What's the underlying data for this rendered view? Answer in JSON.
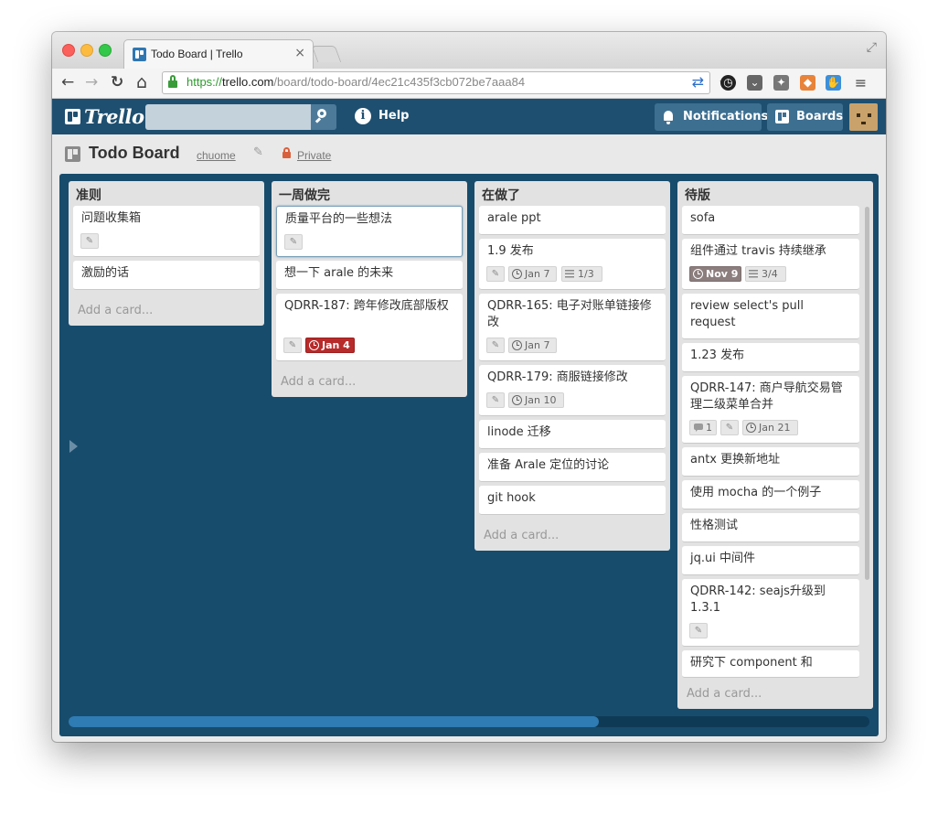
{
  "browser": {
    "tab_title": "Todo Board | Trello",
    "tab_close": "×",
    "url_scheme": "https://",
    "url_host": "trello.com",
    "url_path": "/board/todo-board/4ec21c435f3cb072be7aaa84",
    "nav": {
      "back": "←",
      "forward": "→",
      "reload": "↻",
      "home": "⌂"
    },
    "extension_icons": [
      "redirect-icon",
      "star-icon",
      "clock-extension-icon",
      "pocket-icon",
      "puzzle-icon",
      "shield-icon",
      "hand-icon",
      "menu-icon"
    ]
  },
  "header": {
    "logo": "Trello",
    "search_value": "",
    "help_label": "Help",
    "help_icon": "i",
    "notifications_label": "Notifications",
    "boards_label": "Boards"
  },
  "board": {
    "title": "Todo Board",
    "org": "chuome",
    "visibility": "Private"
  },
  "lists": [
    {
      "title": "准则",
      "add_card": "Add a card...",
      "cards": [
        {
          "title": "问题收集箱"
        },
        {
          "title": "激励的话"
        }
      ]
    },
    {
      "title": "一周做完",
      "add_card": "Add a card...",
      "cards": [
        {
          "title": "质量平台的一些想法"
        },
        {
          "title": "想一下 arale 的未来"
        },
        {
          "title": "QDRR-187: 跨年修改底部版权",
          "due": "Jan 4"
        }
      ]
    },
    {
      "title": "在做了",
      "add_card": "Add a card...",
      "cards": [
        {
          "title": "arale ppt"
        },
        {
          "title": "1.9 发布",
          "due": "Jan 7",
          "checklist": "1/3"
        },
        {
          "title": "QDRR-165: 电子对账单链接修改",
          "due": "Jan 7"
        },
        {
          "title": "QDRR-179: 商服链接修改",
          "due": "Jan 10"
        },
        {
          "title": "linode 迁移"
        },
        {
          "title": "准备 Arale 定位的讨论"
        },
        {
          "title": "git hook"
        }
      ]
    },
    {
      "title": "待版",
      "add_card": "Add a card...",
      "cards": [
        {
          "title": "sofa"
        },
        {
          "title": "组件通过 travis 持续继承",
          "due": "Nov 9",
          "checklist": "3/4"
        },
        {
          "title": "review select's pull request"
        },
        {
          "title": "1.23 发布"
        },
        {
          "title": "QDRR-147: 商户导航交易管理二级菜单合并",
          "comments": "1",
          "due": "Jan 21"
        },
        {
          "title": "antx 更换新地址"
        },
        {
          "title": "使用 mocha 的一个例子"
        },
        {
          "title": "性格测试"
        },
        {
          "title": "jq.ui 中间件"
        },
        {
          "title": "QDRR-142: seajs升级到 1.3.1"
        },
        {
          "title": "研究下 component 和"
        }
      ]
    }
  ],
  "colors": {
    "header_bg": "#1e4f70",
    "board_bg": "#174c6c",
    "list_bg": "#e2e2e2",
    "due_overdue": "#b72b2b",
    "due_past": "#8c7e7e"
  }
}
